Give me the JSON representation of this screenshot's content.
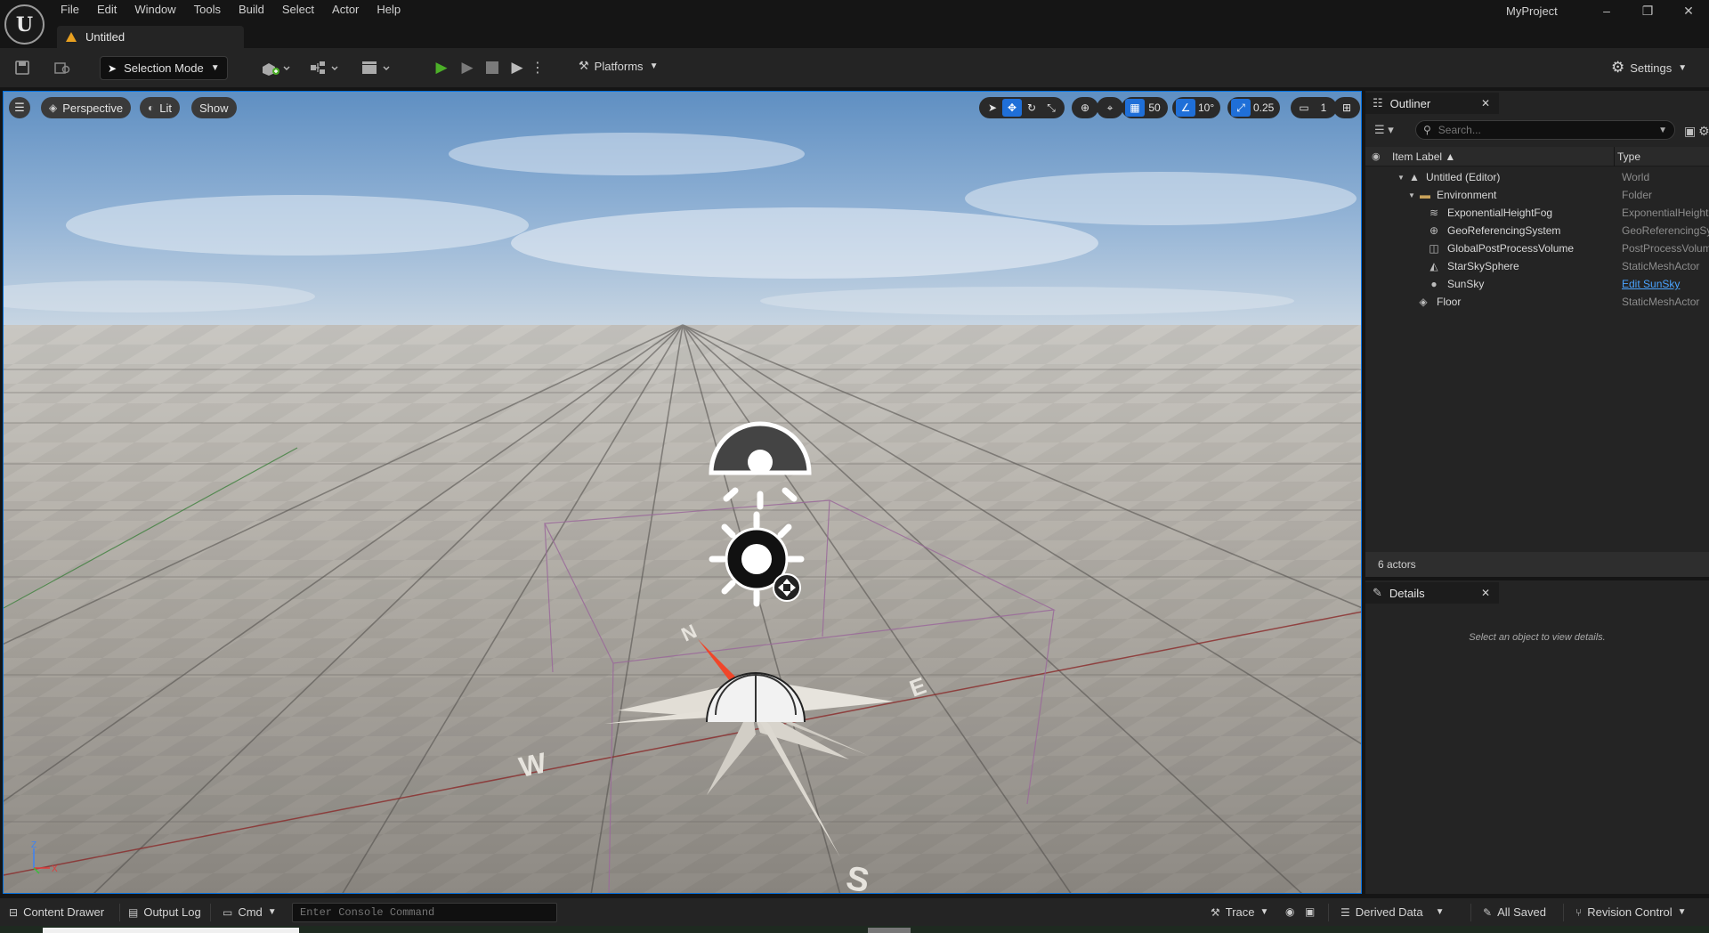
{
  "app": {
    "logo_label": "U",
    "project_name": "MyProject",
    "doc_tab": "Untitled"
  },
  "menu": [
    "File",
    "Edit",
    "Window",
    "Tools",
    "Build",
    "Select",
    "Actor",
    "Help"
  ],
  "window_controls": {
    "minimize": "–",
    "restore": "❐",
    "close": "✕"
  },
  "toolbar": {
    "selection_mode": "Selection Mode",
    "platforms": "Platforms",
    "settings": "Settings"
  },
  "viewport": {
    "perspective": "Perspective",
    "lit": "Lit",
    "show": "Show",
    "grid_snap": "50",
    "rotation_snap": "10°",
    "scale_snap": "0.25",
    "camera_speed": "1",
    "compass": {
      "n": "N",
      "e": "E",
      "s": "S",
      "w": "W"
    },
    "axis": {
      "z": "Z",
      "x": "X"
    }
  },
  "outliner": {
    "tab": "Outliner",
    "search_placeholder": "Search...",
    "col_label": "Item Label ▲",
    "col_type": "Type",
    "rows": [
      {
        "label": "Untitled (Editor)",
        "type": "World",
        "icon": "level-icon"
      },
      {
        "label": "Environment",
        "type": "Folder",
        "icon": "folder-icon"
      },
      {
        "label": "ExponentialHeightFog",
        "type": "ExponentialHeightFog",
        "icon": "fog-icon"
      },
      {
        "label": "GeoReferencingSystem",
        "type": "GeoReferencingSystem",
        "icon": "globe-icon"
      },
      {
        "label": "GlobalPostProcessVolume",
        "type": "PostProcessVolume",
        "icon": "volume-icon"
      },
      {
        "label": "StarSkySphere",
        "type": "StaticMeshActor",
        "icon": "mesh-icon"
      },
      {
        "label": "SunSky",
        "type": "Edit SunSky",
        "icon": "sun-icon"
      },
      {
        "label": "Floor",
        "type": "StaticMeshActor",
        "icon": "mesh-icon"
      }
    ],
    "actor_count": "6 actors"
  },
  "details": {
    "tab": "Details",
    "empty_text": "Select an object to view details."
  },
  "statusbar": {
    "content_drawer": "Content Drawer",
    "output_log": "Output Log",
    "cmd": "Cmd",
    "console_placeholder": "Enter Console Command",
    "trace": "Trace",
    "derived_data": "Derived Data",
    "all_saved": "All Saved",
    "revision_control": "Revision Control"
  },
  "colors": {
    "accent": "#1f6fd8",
    "play": "#4caf28",
    "link": "#4aa3ff"
  }
}
